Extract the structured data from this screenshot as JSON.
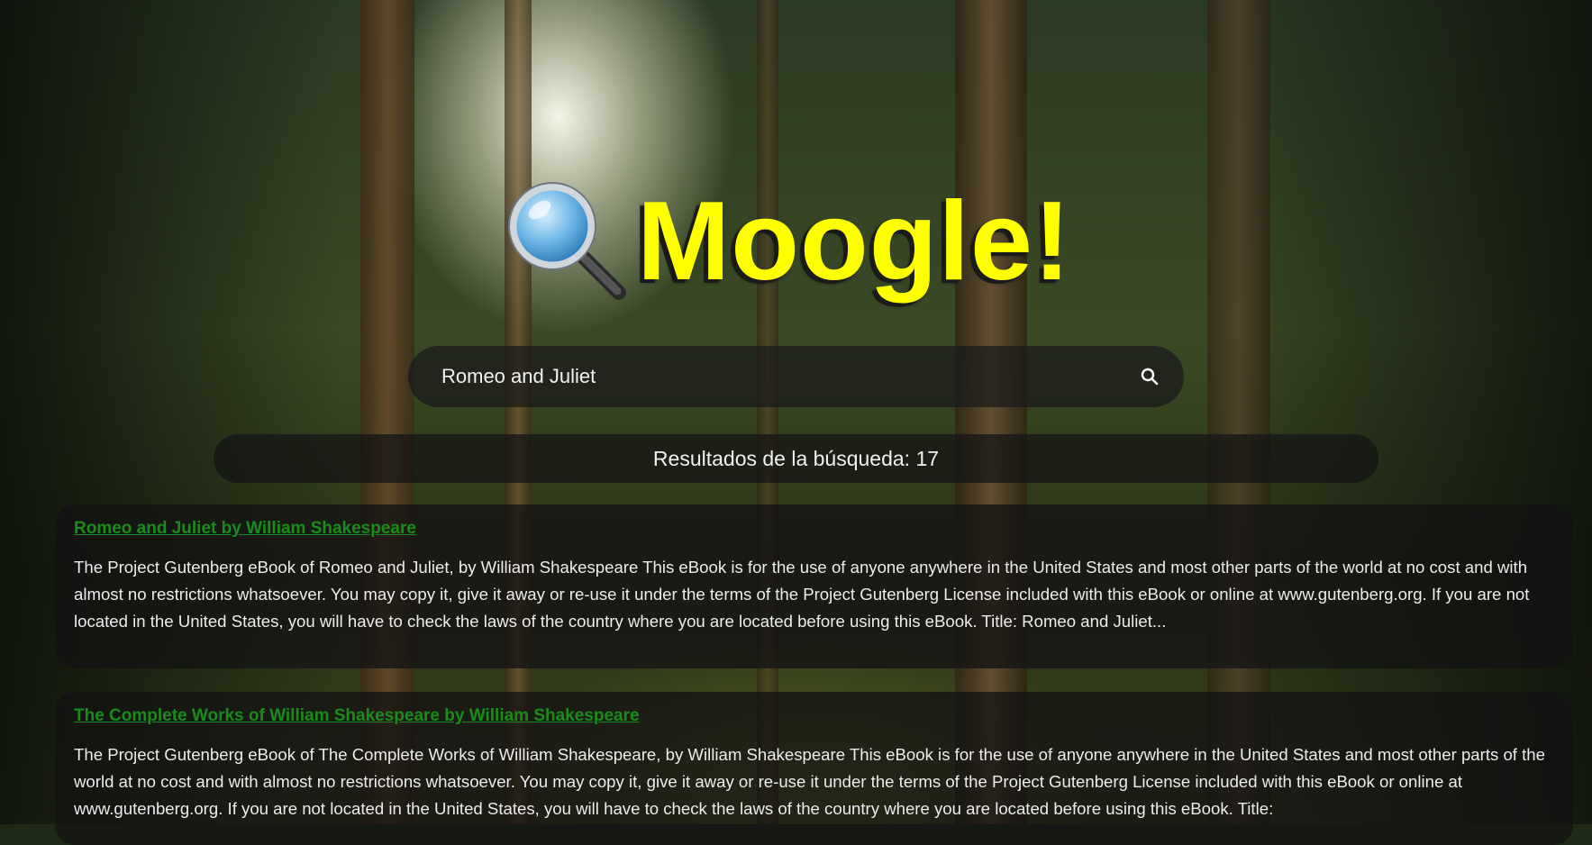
{
  "app": {
    "title": "Moogle!",
    "logo_icon": "magnifying-glass-icon",
    "accent_color": "#ffff00"
  },
  "search": {
    "value": "Romeo and Juliet",
    "placeholder": "",
    "button_icon": "search-icon"
  },
  "results": {
    "count_text": "Resultados de la búsqueda: 17",
    "items": [
      {
        "title": "Romeo and Juliet by William Shakespeare",
        "snippet": "The Project Gutenberg eBook of Romeo and Juliet, by William Shakespeare This eBook is for the use of anyone anywhere in the United States and most other parts of the world at no cost and with almost no restrictions whatsoever. You may copy it, give it away or re-use it under the terms of the Project Gutenberg License included with this eBook or online at www.gutenberg.org. If you are not located in the United States, you will have to check the laws of the country where you are located before using this eBook. Title: Romeo and Juliet..."
      },
      {
        "title": "The Complete Works of William Shakespeare by William Shakespeare",
        "snippet": "The Project Gutenberg eBook of The Complete Works of William Shakespeare, by William Shakespeare This eBook is for the use of anyone anywhere in the United States and most other parts of the world at no cost and with almost no restrictions whatsoever. You may copy it, give it away or re-use it under the terms of the Project Gutenberg License included with this eBook or online at www.gutenberg.org. If you are not located in the United States, you will have to check the laws of the country where you are located before using this eBook. Title:"
      }
    ],
    "link_color": "#1a8c1a"
  }
}
